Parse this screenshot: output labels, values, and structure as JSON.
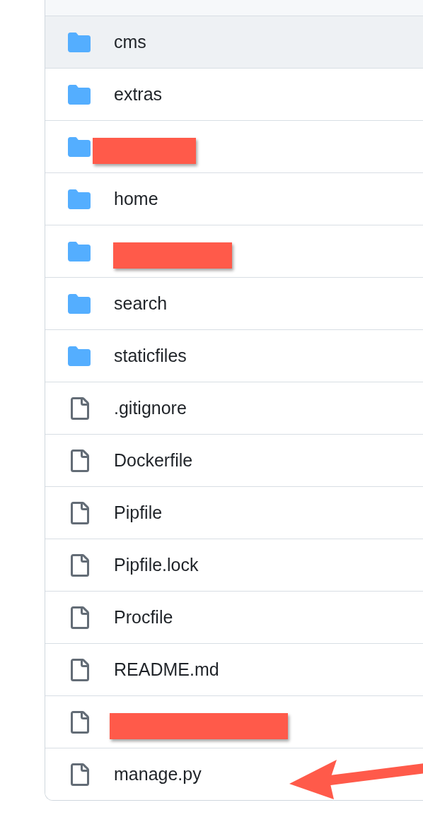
{
  "files": [
    {
      "kind": "folder",
      "name": "cms",
      "highlighted": true
    },
    {
      "kind": "folder",
      "name": "extras",
      "highlighted": false
    },
    {
      "kind": "folder",
      "redacted": true,
      "highlighted": false
    },
    {
      "kind": "folder",
      "name": "home",
      "highlighted": false
    },
    {
      "kind": "folder",
      "redacted": true,
      "highlighted": false
    },
    {
      "kind": "folder",
      "name": "search",
      "highlighted": false
    },
    {
      "kind": "folder",
      "name": "staticfiles",
      "highlighted": false
    },
    {
      "kind": "file",
      "name": ".gitignore",
      "highlighted": false
    },
    {
      "kind": "file",
      "name": "Dockerfile",
      "highlighted": false
    },
    {
      "kind": "file",
      "name": "Pipfile",
      "highlighted": false
    },
    {
      "kind": "file",
      "name": "Pipfile.lock",
      "highlighted": false
    },
    {
      "kind": "file",
      "name": "Procfile",
      "highlighted": false
    },
    {
      "kind": "file",
      "name": "README.md",
      "highlighted": false
    },
    {
      "kind": "file",
      "redacted": true,
      "highlighted": false
    },
    {
      "kind": "file",
      "name": "manage.py",
      "highlighted": false,
      "pointed_at": true
    }
  ]
}
